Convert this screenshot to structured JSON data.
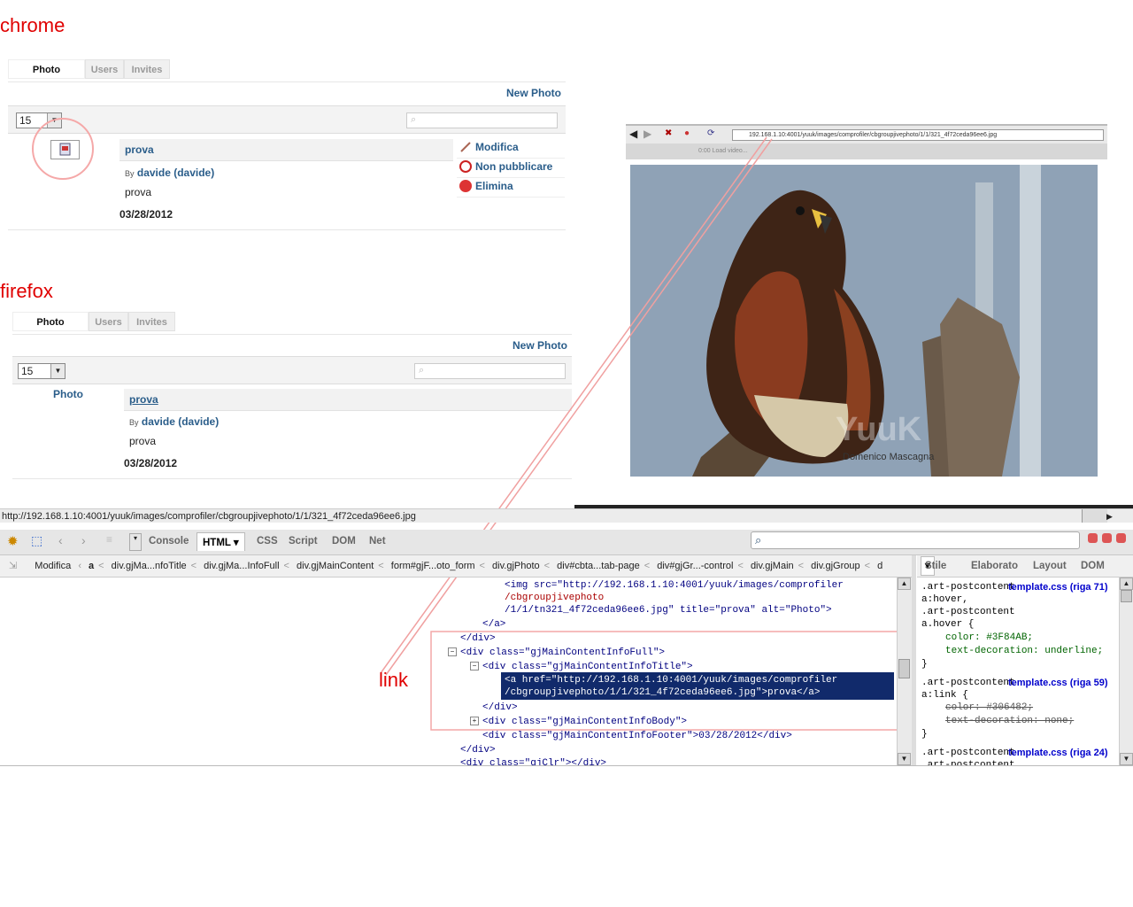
{
  "labels": {
    "chrome": "chrome",
    "firefox": "firefox",
    "link": "link"
  },
  "chrome": {
    "tabs": [
      "Photo",
      "Users",
      "Invites"
    ],
    "new_photo": "New Photo",
    "select_value": "15",
    "item": {
      "title": "prova",
      "by_prefix": "By",
      "author": "davide (davide)",
      "body": "prova",
      "date": "03/28/2012"
    },
    "actions": [
      "Modifica",
      "Non pubblicare",
      "Elimina"
    ]
  },
  "firefox": {
    "tabs": [
      "Photo",
      "Users",
      "Invites"
    ],
    "new_photo": "New Photo",
    "select_value": "15",
    "image_alt": "Photo",
    "item": {
      "title": "prova",
      "by_prefix": "By",
      "author": "davide (davide)",
      "body": "prova",
      "date": "03/28/2012"
    }
  },
  "mini_browser": {
    "url": "192.168.1.10:4001/yuuk/images/comprofiler/cbgroupjivephoto/1/1/321_4f72ceda96ee6.jpg",
    "media_text": "0:00    Load video...",
    "watermark": "YuuK",
    "credit": "Domenico Mascagna"
  },
  "status_url": "http://192.168.1.10:4001/yuuk/images/comprofiler/cbgroupjivephoto/1/1/321_4f72ceda96ee6.jpg",
  "firebug": {
    "tabs": [
      "Console",
      "HTML",
      "CSS",
      "Script",
      "DOM",
      "Net"
    ],
    "active_tab": "HTML",
    "breadcrumb": [
      "Modifica",
      "a",
      "div.gjMa...nfoTitle",
      "div.gjMa...InfoFull",
      "div.gjMainContent",
      "form#gjF...oto_form",
      "div.gjPhoto",
      "div#cbta...tab-page",
      "div#gjGr...-control",
      "div.gjMain",
      "div.gjGroup",
      "d"
    ],
    "side_tabs": [
      "Stile",
      "Elaborato",
      "Layout",
      "DOM"
    ],
    "html_lines": [
      "<img src=\"http://192.168.1.10:4001/yuuk/images/comprofiler",
      "/cbgroupjivephoto",
      "/1/1/tn321_4f72ceda96ee6.jpg\" title=\"prova\" alt=\"Photo\">",
      "</a>",
      "</div>",
      "<div class=\"gjMainContentInfoFull\">",
      "<div class=\"gjMainContentInfoTitle\">",
      "<a href=\"http://192.168.1.10:4001/yuuk/images/comprofiler",
      "/cbgroupjivephoto/1/1/321_4f72ceda96ee6.jpg\">prova</a>",
      "</div>",
      "<div class=\"gjMainContentInfoBody\">",
      "<div class=\"gjMainContentInfoFooter\">03/28/2012</div>",
      "</div>",
      "<div class=\"gjClr\"></div>"
    ],
    "css_rules": [
      {
        "selector": ".art-postcontent\na:hover,\n.art-postcontent\na.hover {",
        "source": "template.css (riga 71)",
        "props": [
          "color: #3F84AB;",
          "text-decoration: underline;"
        ],
        "close": "}"
      },
      {
        "selector": ".art-postcontent\na:link {",
        "source": "template.css (riga 59)",
        "props": [
          "color: #306482;",
          "text-decoration: none;"
        ],
        "close": "}"
      },
      {
        "selector": ".art-postcontent\n.art-postcontent",
        "source": "template.css (riga 24)"
      }
    ]
  }
}
